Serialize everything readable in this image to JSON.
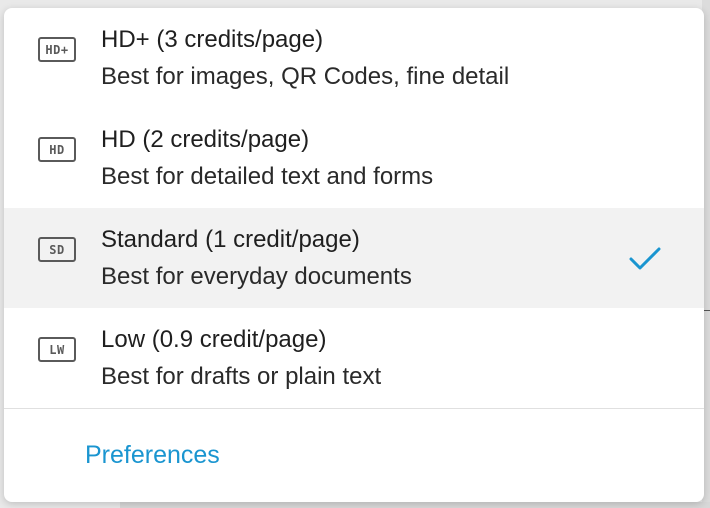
{
  "menu": {
    "options": [
      {
        "icon_text": "HD+",
        "icon": "hd-plus-quality-icon",
        "title": "HD+ (3 credits/page)",
        "description": "Best for images, QR Codes, fine detail",
        "selected": false
      },
      {
        "icon_text": "HD",
        "icon": "hd-quality-icon",
        "title": "HD (2 credits/page)",
        "description": "Best for detailed text and forms",
        "selected": false
      },
      {
        "icon_text": "SD",
        "icon": "sd-quality-icon",
        "title": "Standard (1 credit/page)",
        "description": "Best for everyday documents",
        "selected": true
      },
      {
        "icon_text": "LW",
        "icon": "low-quality-icon",
        "title": "Low (0.9 credit/page)",
        "description": "Best for drafts or plain text",
        "selected": false
      }
    ],
    "preferences_label": "Preferences"
  },
  "colors": {
    "accent": "#1a95d0",
    "selected_bg": "#f2f2f2",
    "icon": "#5a5a5a",
    "text": "#1f1f1f"
  }
}
